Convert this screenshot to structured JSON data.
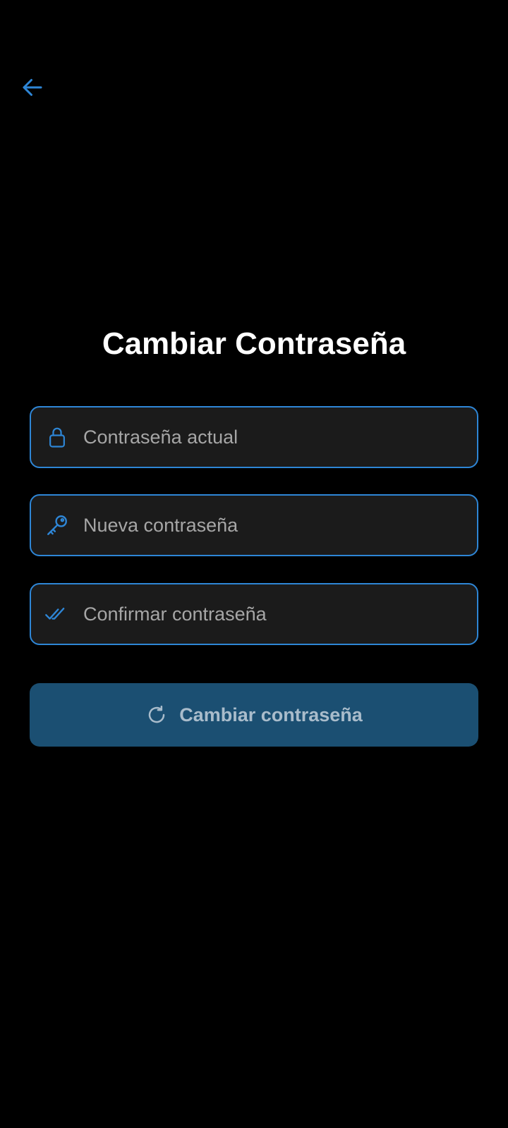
{
  "header": {
    "back_icon": "arrow-left-icon"
  },
  "main": {
    "title": "Cambiar Contraseña",
    "fields": [
      {
        "icon": "lock-icon",
        "placeholder": "Contraseña actual",
        "value": ""
      },
      {
        "icon": "key-icon",
        "placeholder": "Nueva contraseña",
        "value": ""
      },
      {
        "icon": "double-check-icon",
        "placeholder": "Confirmar contraseña",
        "value": ""
      }
    ],
    "submit": {
      "icon": "refresh-icon",
      "label": "Cambiar contraseña"
    }
  },
  "colors": {
    "background": "#000000",
    "accent": "#2e86d6",
    "field_background": "#1b1b1b",
    "button_background": "#1b4f72",
    "button_text": "#a9bccb",
    "placeholder_text": "#a6a6a6",
    "title_text": "#ffffff"
  }
}
